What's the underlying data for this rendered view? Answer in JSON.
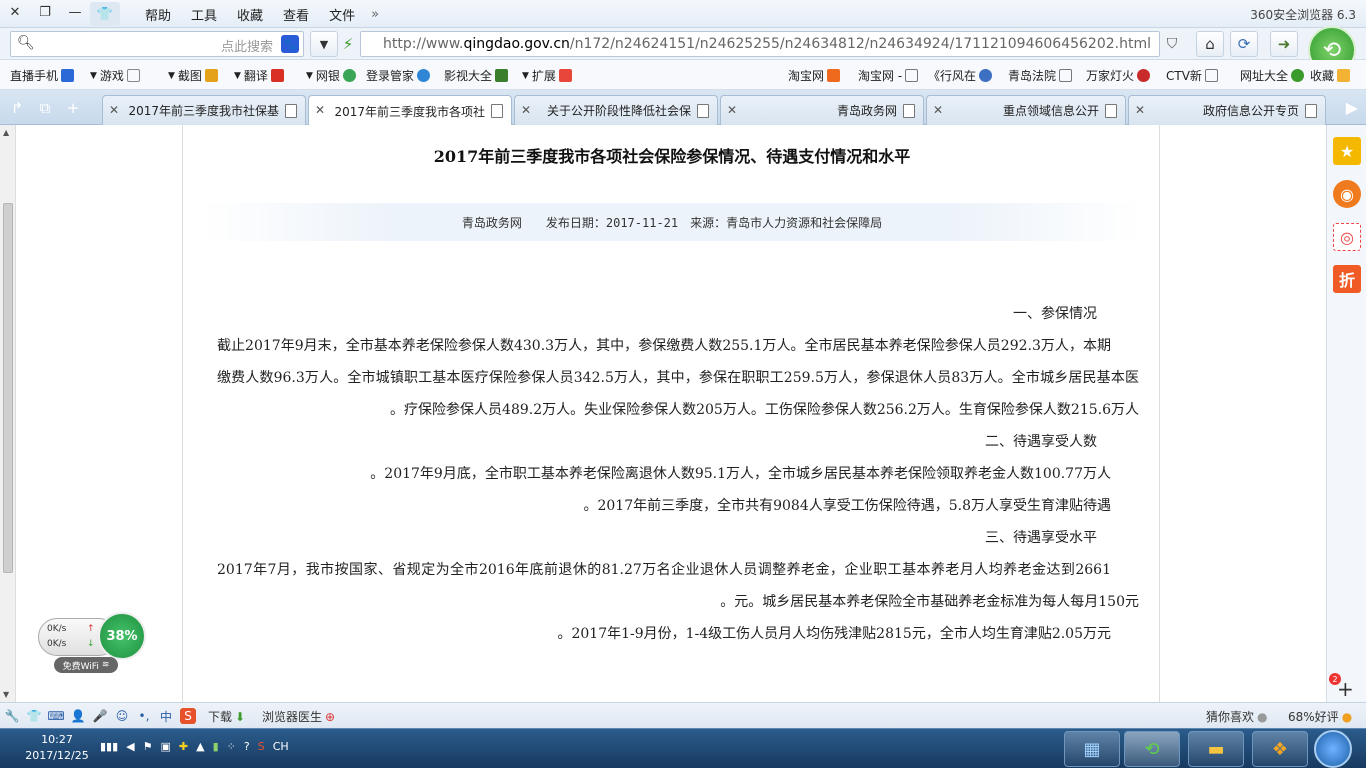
{
  "window": {
    "app_title": "360安全浏览器 6.3",
    "menus": [
      "文件",
      "查看",
      "收藏",
      "工具",
      "帮助"
    ],
    "menu_overflow": "»"
  },
  "nav": {
    "url_prefix": "http://www.",
    "url_domain": "qingdao.gov.cn",
    "url_path": "/n172/n24624151/n24625255/n24634812/n24634924/171121094606456202.html",
    "search_placeholder": "点此搜索"
  },
  "bookmarks": [
    {
      "label": "收藏",
      "color": "#f2b233"
    },
    {
      "label": "网址大全",
      "color": "#3a9a2a"
    },
    {
      "label": "CTV新",
      "color": "#ffffff"
    },
    {
      "label": "万家灯火",
      "color": "#c92b2b"
    },
    {
      "label": "青岛法院",
      "color": "#ffffff"
    },
    {
      "label": "《行风在",
      "color": "#3d6fc2"
    },
    {
      "label": "淘宝网 -",
      "color": "#ffffff"
    },
    {
      "label": "淘宝网",
      "color": "#f06a1d"
    },
    {
      "label": "扩展",
      "color": "#e8463a"
    },
    {
      "label": "影视大全",
      "color": "#3a7d2a"
    },
    {
      "label": "登录管家",
      "color": "#2f86d6"
    },
    {
      "label": "网银",
      "color": "#3aa655"
    },
    {
      "label": "翻译",
      "color": "#d93025"
    },
    {
      "label": "截图",
      "color": "#e3a21a"
    },
    {
      "label": "游戏",
      "color": "#888888"
    },
    {
      "label": "直播手机",
      "color": "#2a6ad6"
    }
  ],
  "tabs": [
    {
      "label": "政府信息公开专页",
      "active": false
    },
    {
      "label": "重点领域信息公开",
      "active": false
    },
    {
      "label": "青岛政务网",
      "active": false
    },
    {
      "label": "关于公开阶段性降低社会保",
      "active": false
    },
    {
      "label": "2017年前三季度我市各项社",
      "active": true
    },
    {
      "label": "2017年前三季度我市社保基",
      "active": false
    }
  ],
  "article": {
    "title": "2017年前三季度我市各项社会保险参保情况、待遇支付情况和水平",
    "meta": "青岛政务网　　发布日期：2017-11-21　来源：青岛市人力资源和社会保障局",
    "paragraphs": [
      {
        "type": "head",
        "text": "一、参保情况"
      },
      {
        "type": "body",
        "text": "截止2017年9月末，全市基本养老保险参保人数430.3万人，其中，参保缴费人数255.1万人。全市居民基本养老保险参保人员292.3万人，本期缴费人数96.3万人。全市城镇职工基本医疗保险参保人员342.5万人，其中，参保在职职工259.5万人，参保退休人员83万人。全市城乡居民基本医疗保险参保人员489.2万人。失业保险参保人数205万人。工伤保险参保人数256.2万人。生育保险参保人数215.6万人。"
      },
      {
        "type": "head",
        "text": "二、待遇享受人数"
      },
      {
        "type": "body",
        "text": "2017年9月底，全市职工基本养老保险离退休人数95.1万人，全市城乡居民基本养老保险领取养老金人数100.77万人。"
      },
      {
        "type": "body",
        "text": "2017年前三季度，全市共有9084人享受工伤保险待遇，5.8万人享受生育津贴待遇。"
      },
      {
        "type": "head",
        "text": "三、待遇享受水平"
      },
      {
        "type": "body",
        "text": "2017年7月，我市按国家、省规定为全市2016年底前退休的81.27万名企业退休人员调整养老金，企业职工基本养老月人均养老金达到2661元。城乡居民基本养老保险全市基础养老金标准为每人每月150元。"
      },
      {
        "type": "body",
        "text": "2017年1-9月份，1-4级工伤人员月人均伤残津贴2815元，全市人均生育津贴2.05万元。"
      }
    ]
  },
  "speed_widget": {
    "up_rate": "0K/s",
    "down_rate": "0K/s",
    "percent": "38%",
    "wifi_label": "免费WiFi"
  },
  "statusbar": {
    "left_label": "浏览器医生",
    "download_label": "下载",
    "ime_label": "中",
    "right_label": "猜你喜欢",
    "right2_label": "68%好评"
  },
  "taskbar": {
    "time": "10:27",
    "date": "2017/12/25",
    "lang": "CH"
  }
}
